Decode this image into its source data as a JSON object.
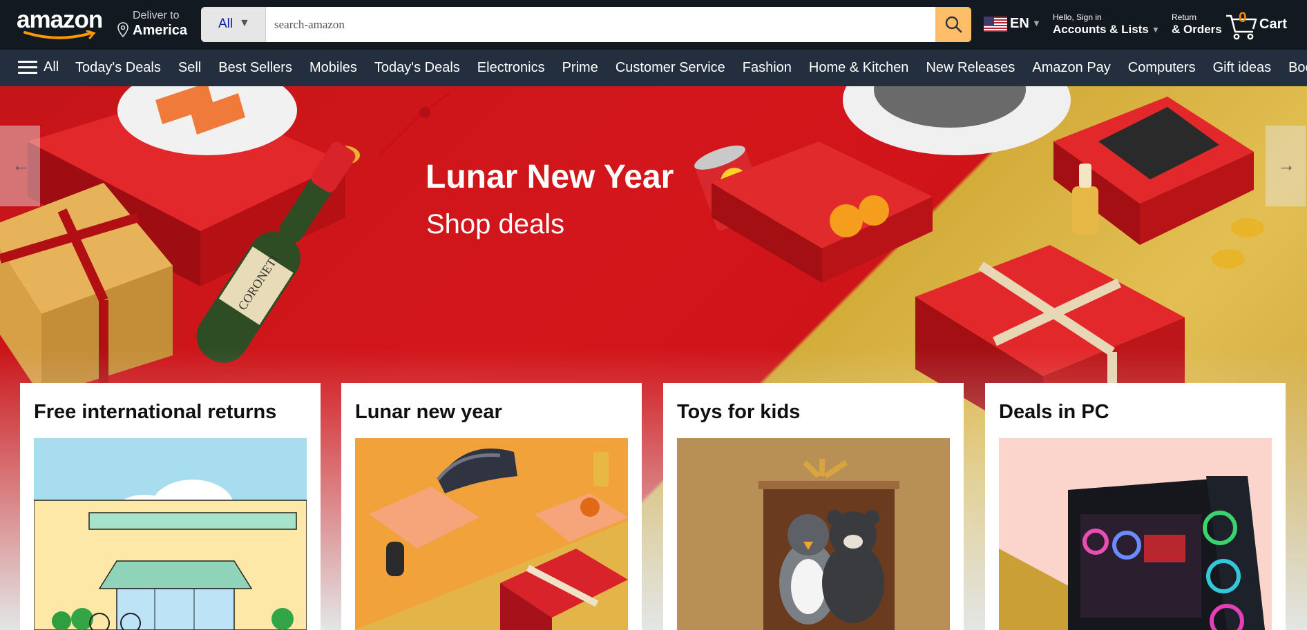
{
  "header": {
    "logo_text": "amazon",
    "deliver_line1": "Deliver to",
    "deliver_line2": "America",
    "search_category": "All",
    "search_placeholder": "search-amazon",
    "language": "EN",
    "account_line1": "Hello, Sign in",
    "account_line2": "Accounts & Lists",
    "orders_line1": "Return",
    "orders_line2": "& Orders",
    "cart_count": "0",
    "cart_label": "Cart"
  },
  "nav": {
    "all_label": "All",
    "items": [
      "Today's Deals",
      "Sell",
      "Best Sellers",
      "Mobiles",
      "Today's Deals",
      "Electronics",
      "Prime",
      "Customer Service",
      "Fashion",
      "Home & Kitchen",
      "New Releases",
      "Amazon Pay",
      "Computers",
      "Gift ideas",
      "Books"
    ]
  },
  "hero": {
    "title": "Lunar New Year",
    "subtitle": "Shop deals",
    "prev_icon": "←",
    "next_icon": "→",
    "bottle_label": "CORONETI"
  },
  "cards": [
    {
      "title": "Free international returns",
      "image": "storefront-illustration"
    },
    {
      "title": "Lunar new year",
      "image": "gifts-and-appliances"
    },
    {
      "title": "Toys for kids",
      "image": "plush-toys-in-box"
    },
    {
      "title": "Deals in PC",
      "image": "gaming-pc-tower"
    }
  ],
  "colors": {
    "header_bg": "#131921",
    "nav_bg": "#232f3e",
    "search_button": "#febd69",
    "cart_count": "#f08804",
    "hero_red": "#d3161b",
    "hero_gold": "#e3bf53"
  }
}
